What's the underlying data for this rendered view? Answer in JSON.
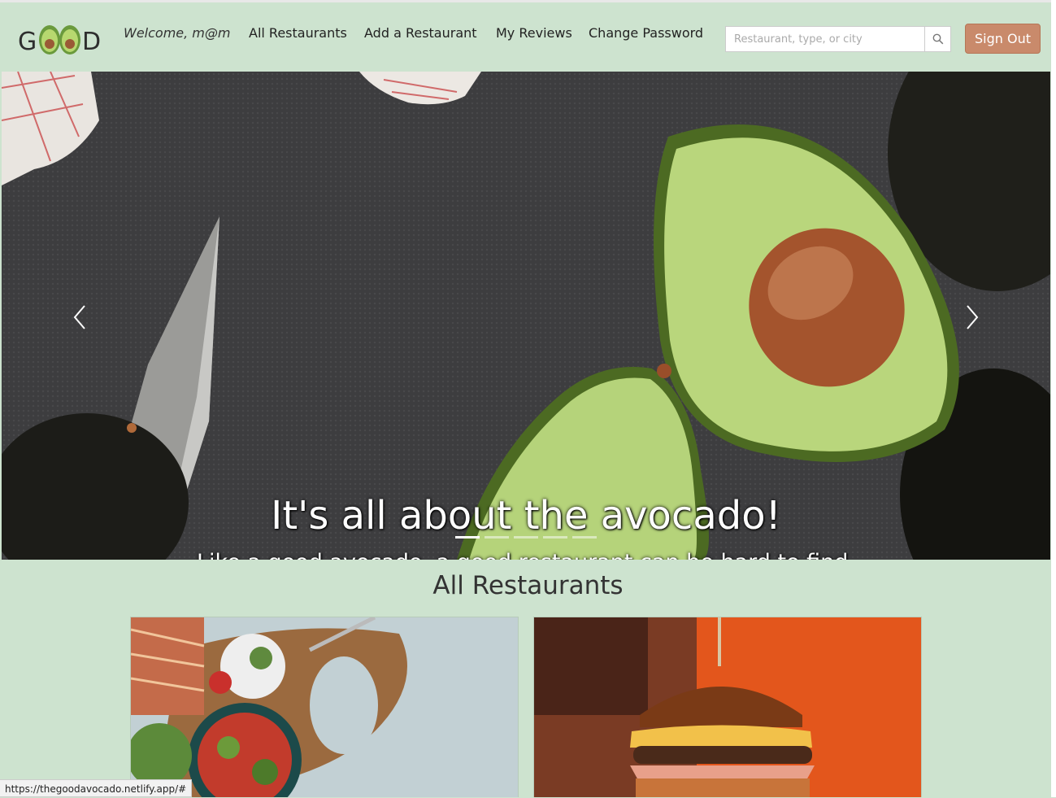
{
  "nav": {
    "logo_letters": [
      "G",
      "D"
    ],
    "welcome": "Welcome, m@m",
    "links": [
      "All Restaurants",
      "Add a Restaurant",
      "My Reviews",
      "Change Password"
    ],
    "search_placeholder": "Restaurant, type, or city",
    "signout_label": "Sign Out"
  },
  "hero": {
    "title": "It's all about the avocado!",
    "subtitle": "Like a good avocado, a good restaurant can be hard to find.",
    "slide_count": 5,
    "active_slide": 1
  },
  "section": {
    "title": "All Restaurants"
  },
  "status_url": "https://thegoodavocado.netlify.app/#",
  "colors": {
    "background": "#cde3cf",
    "accent_button": "#c98a6b",
    "avocado_flesh": "#b8d67a",
    "avocado_skin": "#2a2a22"
  }
}
